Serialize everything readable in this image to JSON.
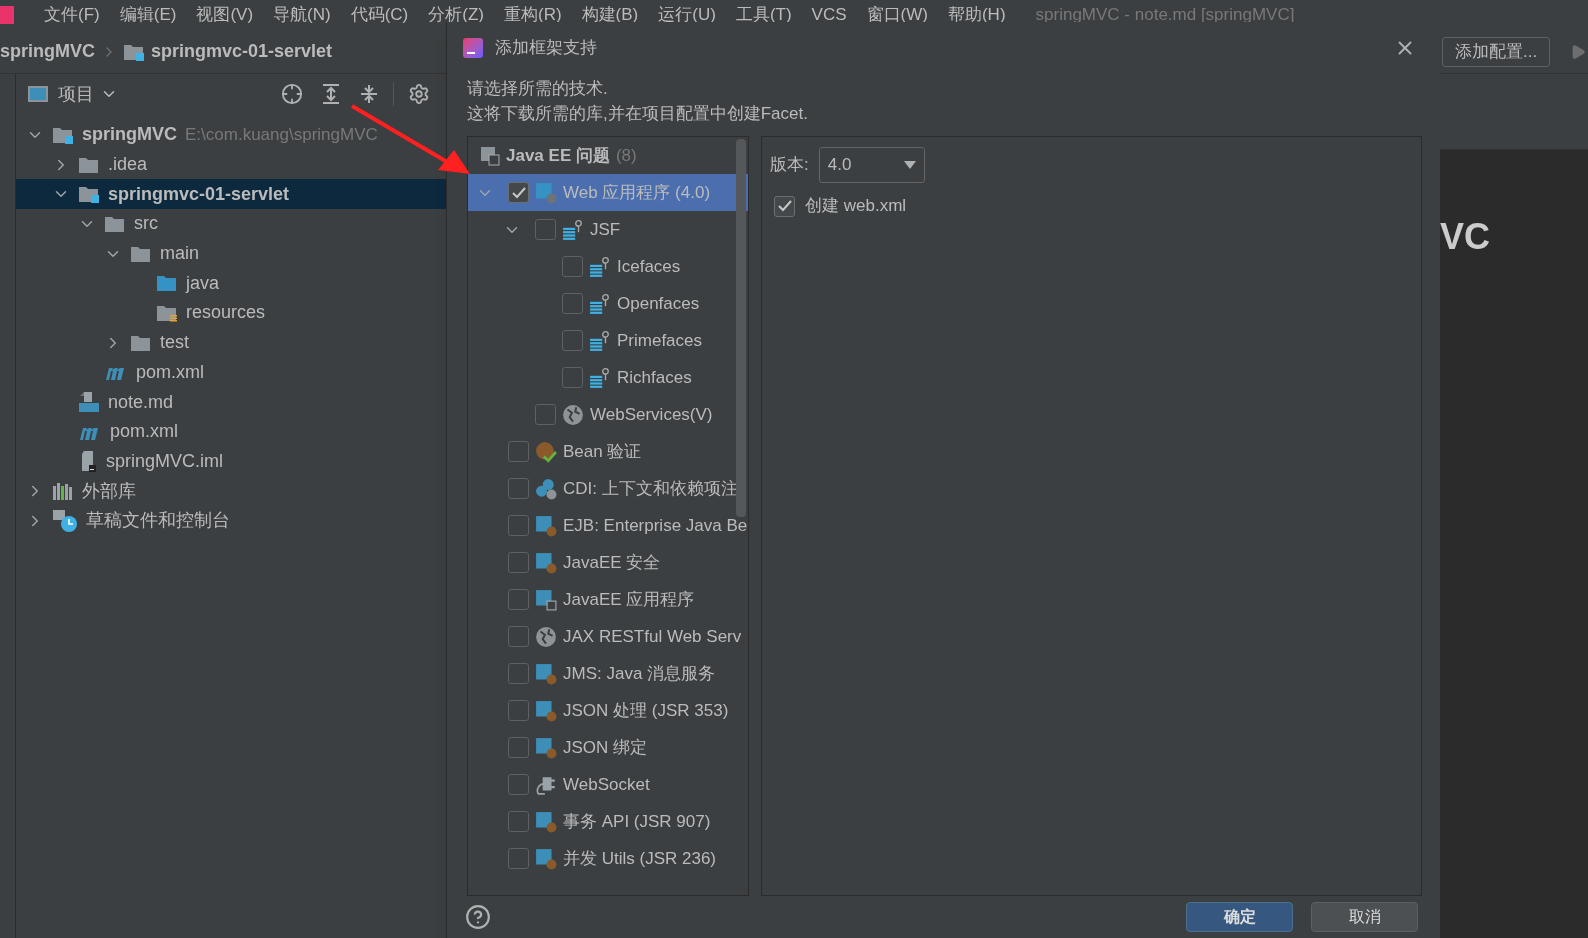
{
  "menu_bar": {
    "items": [
      "文件(F)",
      "编辑(E)",
      "视图(V)",
      "导航(N)",
      "代码(C)",
      "分析(Z)",
      "重构(R)",
      "构建(B)",
      "运行(U)",
      "工具(T)",
      "VCS",
      "窗口(W)",
      "帮助(H)"
    ],
    "window_title": "springMVC - note.md [springMVC]"
  },
  "breadcrumbs": [
    {
      "label": "springMVC",
      "kind": "project"
    },
    {
      "label": "springmvc-01-servlet",
      "kind": "module"
    }
  ],
  "project_panel": {
    "view_label": "项目",
    "tree": [
      {
        "name": "springMVC",
        "kind": "module",
        "path": "E:\\com.kuang\\springMVC",
        "selected": false,
        "expanded": true,
        "children": [
          {
            "name": ".idea",
            "kind": "folder",
            "selected": false,
            "expanded": false
          },
          {
            "name": "springmvc-01-servlet",
            "kind": "module",
            "selected": true,
            "expanded": true,
            "children": [
              {
                "name": "src",
                "kind": "folder",
                "selected": false,
                "expanded": true,
                "children": [
                  {
                    "name": "main",
                    "kind": "folder",
                    "selected": false,
                    "expanded": true,
                    "children": [
                      {
                        "name": "java",
                        "kind": "source-folder",
                        "selected": false
                      },
                      {
                        "name": "resources",
                        "kind": "resource-folder",
                        "selected": false
                      }
                    ]
                  },
                  {
                    "name": "test",
                    "kind": "folder",
                    "selected": false,
                    "expanded": false
                  }
                ]
              },
              {
                "name": "pom.xml",
                "kind": "maven",
                "selected": false
              }
            ]
          },
          {
            "name": "note.md",
            "kind": "markdown",
            "selected": false
          },
          {
            "name": "pom.xml",
            "kind": "maven",
            "selected": false
          },
          {
            "name": "springMVC.iml",
            "kind": "iml",
            "selected": false
          }
        ]
      },
      {
        "name": "外部库",
        "kind": "libraries",
        "selected": false,
        "expanded": false
      },
      {
        "name": "草稿文件和控制台",
        "kind": "scratches",
        "selected": false,
        "expanded": false
      }
    ]
  },
  "dialog": {
    "title": "添加框架支持",
    "description": [
      "请选择所需的技术.",
      "这将下载所需的库,并在项目配置中创建Facet."
    ],
    "group": {
      "label": "Java EE 问题",
      "count": "(8)"
    },
    "frameworks": [
      {
        "label": "Web 应用程序 (4.0)",
        "kind": "web",
        "checked": true,
        "selected": true,
        "expanded": true,
        "children": [
          {
            "label": "JSF",
            "kind": "jsf",
            "checked": false,
            "selected": false,
            "expanded": true,
            "children": [
              {
                "label": "Icefaces",
                "kind": "jsf",
                "checked": false,
                "selected": false
              },
              {
                "label": "Openfaces",
                "kind": "jsf",
                "checked": false,
                "selected": false
              },
              {
                "label": "Primefaces",
                "kind": "jsf",
                "checked": false,
                "selected": false
              },
              {
                "label": "Richfaces",
                "kind": "jsf",
                "checked": false,
                "selected": false
              }
            ]
          },
          {
            "label": "WebServices(V)",
            "kind": "globe",
            "checked": false,
            "selected": false
          }
        ]
      },
      {
        "label": "Bean 验证",
        "kind": "bean",
        "checked": false,
        "selected": false
      },
      {
        "label": "CDI: 上下文和依赖项注",
        "kind": "cdi",
        "checked": false,
        "selected": false
      },
      {
        "label": "EJB: Enterprise Java Be",
        "kind": "javaee",
        "checked": false,
        "selected": false
      },
      {
        "label": "JavaEE 安全",
        "kind": "javaee",
        "checked": false,
        "selected": false
      },
      {
        "label": "JavaEE 应用程序",
        "kind": "javaee-app",
        "checked": false,
        "selected": false
      },
      {
        "label": "JAX RESTful Web Serv",
        "kind": "globe",
        "checked": false,
        "selected": false
      },
      {
        "label": "JMS: Java 消息服务",
        "kind": "javaee",
        "checked": false,
        "selected": false
      },
      {
        "label": "JSON 处理 (JSR 353)",
        "kind": "javaee",
        "checked": false,
        "selected": false
      },
      {
        "label": "JSON 绑定",
        "kind": "javaee",
        "checked": false,
        "selected": false
      },
      {
        "label": "WebSocket",
        "kind": "websocket",
        "checked": false,
        "selected": false
      },
      {
        "label": "事务 API (JSR 907)",
        "kind": "javaee",
        "checked": false,
        "selected": false
      },
      {
        "label": "并发 Utils (JSR 236)",
        "kind": "javaee",
        "checked": false,
        "selected": false
      }
    ],
    "version_label": "版本:",
    "version_value": "4.0",
    "create_option": {
      "label": "创建 web.xml",
      "checked": true
    },
    "buttons": [
      {
        "label": "确定",
        "kind": "primary"
      },
      {
        "label": "取消",
        "kind": "secondary"
      }
    ]
  },
  "editor": {
    "run_config_button": "添加配置...",
    "heading_fragment": "VC"
  }
}
